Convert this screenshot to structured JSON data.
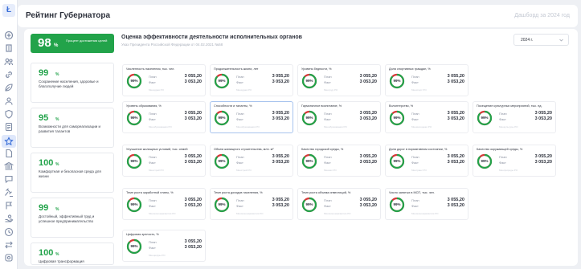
{
  "app": {
    "logo": "Ł",
    "title": "Рейтинг Губернатора",
    "dashboard_label": "Дашборд за 2024 год"
  },
  "sidebar": {
    "icons": [
      "plus-circle-icon",
      "building-icon",
      "people-icon",
      "link-icon",
      "leaf-icon",
      "users-icon",
      "shield-icon",
      "doc-icon",
      "star-icon",
      "file-icon",
      "government-icon",
      "chat-icon",
      "gavel-icon",
      "flag-icon",
      "hand-icon",
      "clock-icon",
      "transfer-icon",
      "settings-icon"
    ],
    "active_index": 8
  },
  "summary": {
    "value": "98",
    "unit": "%",
    "label": "Процент достижения целей"
  },
  "section": {
    "title": "Оценка эффективности деятельности исполнительных органов",
    "subtitle": "Указ Президента Российской Федерации от 04.02.2021 №68",
    "year": "2024 г."
  },
  "colors": {
    "green": "#22a34a",
    "red": "#d63a3a",
    "accent": "#3a6fd8"
  },
  "categories": [
    {
      "value": "99",
      "unit": "%",
      "name": "Сохранение населения, здоровье и благополучие людей"
    },
    {
      "value": "95",
      "unit": "%",
      "name": "Возможности для самореализации и развития талантов"
    },
    {
      "value": "100",
      "unit": "%",
      "name": "Комфортная и безопасная среда для жизни"
    },
    {
      "value": "99",
      "unit": "%",
      "name": "Достойный, эффективный труд и успешное предпринимательство"
    },
    {
      "value": "100",
      "unit": "%",
      "name": "Цифровая трансформация"
    }
  ],
  "card_labels": {
    "plan": "План",
    "fact": "Факт"
  },
  "cards": [
    {
      "title": "Численность населения, тыс. чел.",
      "pct": "99%",
      "percent_value": 99,
      "plan": "3 055,20",
      "fact": "3 053,20",
      "foot": "Минздрав РО"
    },
    {
      "title": "Продолжительность жизни, лет",
      "pct": "99%",
      "percent_value": 99,
      "plan": "3 055,20",
      "fact": "3 053,20",
      "foot": "Минздрав РО"
    },
    {
      "title": "Уровень бедности, %",
      "pct": "99%",
      "percent_value": 99,
      "plan": "3 055,20",
      "fact": "3 053,20",
      "foot": "Минтруд РО"
    },
    {
      "title": "Доля спортивных граждан, %",
      "pct": "99%",
      "percent_value": 99,
      "plan": "3 055,20",
      "fact": "3 053,20",
      "foot": "Минспорт РО"
    },
    {
      "title": "Уровень образования, %",
      "pct": "99%",
      "percent_value": 99,
      "plan": "3 055,20",
      "fact": "3 053,20",
      "foot": "Минобразования РО"
    },
    {
      "title": "Способности и таланты, %",
      "pct": "99%",
      "percent_value": 99,
      "plan": "3 055,20",
      "fact": "3 053,20",
      "foot": "Минобразования РО"
    },
    {
      "title": "Гармоничное воспитание, %",
      "pct": "99%",
      "percent_value": 99,
      "plan": "3 055,20",
      "fact": "3 053,20",
      "foot": "Минобразования РО"
    },
    {
      "title": "Волонтерство, %",
      "pct": "99%",
      "percent_value": 99,
      "plan": "3 055,20",
      "fact": "3 053,20",
      "foot": "Минмолодежи РО"
    },
    {
      "title": "Посещение культурных мероприятий, тыс. ед.",
      "pct": "99%",
      "percent_value": 99,
      "plan": "3 055,20",
      "fact": "3 053,20",
      "foot": "Минкультуры РО"
    },
    {
      "title": "Улучшение жилищных условий, тыс. семей",
      "pct": "99%",
      "percent_value": 99,
      "plan": "3 055,20",
      "fact": "3 053,20",
      "foot": "Минстрой РО"
    },
    {
      "title": "Объем жилищного строительства, млн. м²",
      "pct": "99%",
      "percent_value": 99,
      "plan": "3 055,20",
      "fact": "3 053,20",
      "foot": "Минстрой РО"
    },
    {
      "title": "Качество городской среды, %",
      "pct": "99%",
      "percent_value": 99,
      "plan": "3 055,20",
      "fact": "3 053,20",
      "foot": "Минжкх РО"
    },
    {
      "title": "Доля дорог в нормативном состоянии, %",
      "pct": "99%",
      "percent_value": 99,
      "plan": "3 055,20",
      "fact": "3 053,20",
      "foot": "Минтранс РО"
    },
    {
      "title": "Качество окружающей среды, %",
      "pct": "99%",
      "percent_value": 99,
      "plan": "3 055,20",
      "fact": "3 053,20",
      "foot": "Минприроды РО"
    },
    {
      "title": "Темп роста заработной платы, %",
      "pct": "99%",
      "percent_value": 99,
      "plan": "3 055,20",
      "fact": "3 053,20",
      "foot": "Минэкономразвития РО"
    },
    {
      "title": "Темп роста доходов населения, %",
      "pct": "99%",
      "percent_value": 99,
      "plan": "3 055,20",
      "fact": "3 053,20",
      "foot": "Минэкономразвития РО"
    },
    {
      "title": "Темп роста объема инвестиций, %",
      "pct": "99%",
      "percent_value": 99,
      "plan": "3 055,20",
      "fact": "3 053,20",
      "foot": "Минэкономразвития РО"
    },
    {
      "title": "Число занятых в МСП, тыс. чел.",
      "pct": "99%",
      "percent_value": 99,
      "plan": "3 055,20",
      "fact": "3 053,20",
      "foot": "Минэкономразвития РО"
    },
    {
      "title": "Цифровая зрелость, %",
      "pct": "99%",
      "percent_value": 99,
      "plan": "3 055,20",
      "fact": "3 053,20",
      "foot": "Минцифры РО"
    }
  ]
}
